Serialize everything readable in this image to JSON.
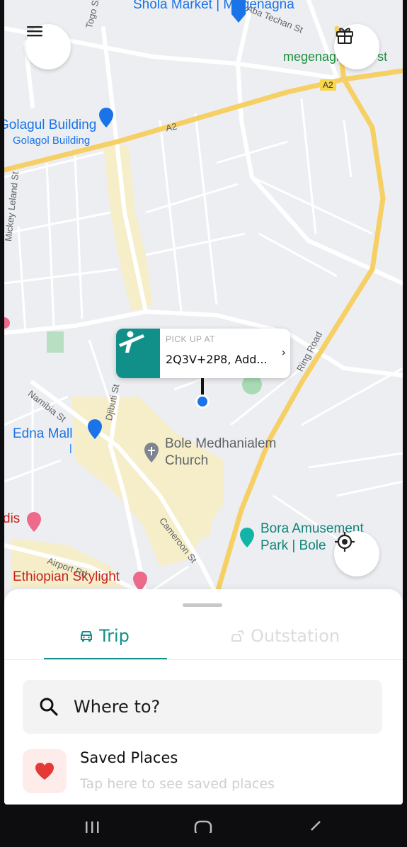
{
  "map": {
    "labels": {
      "shola_market": "Shola Market | Megenagna",
      "golagul_building": "Golagul Building",
      "golagol_building": "Golagol Building",
      "megenagna_taxi": "megenagna taxi st",
      "edna_mall": "Edna Mall",
      "edna_mall_bar": "|",
      "bole_medhanialem": "Bole Medhanialem",
      "church": "Church",
      "bora_park_1": "Bora Amusement",
      "bora_park_2": "Park | Bole",
      "adis": "dis",
      "ethiopian_skylight": "Ethiopian Skylight"
    },
    "streets": {
      "a2_left": "A2",
      "a2_badge": "A2",
      "ring_road": "Ring Road",
      "djibuti": "Djibuti St",
      "namibia": "Namibia St",
      "cameroon": "Cameroon St",
      "airport": "Airport Rd",
      "mickey_leland": "Mickey Leland St",
      "togo": "Togo St",
      "aba_techan": "Aba Techan St"
    }
  },
  "pickup": {
    "label": "PICK UP AT",
    "address": "2Q3V+2P8, Add...",
    "chevron": "›"
  },
  "tabs": {
    "trip": "Trip",
    "outstation": "Outstation"
  },
  "search": {
    "placeholder": "Where to?"
  },
  "saved_places": {
    "title": "Saved Places",
    "subtitle": "Tap here to see saved places"
  },
  "colors": {
    "brand_teal": "#11908a",
    "road_yellow": "#f6cf65",
    "heart_red": "#e53935"
  }
}
